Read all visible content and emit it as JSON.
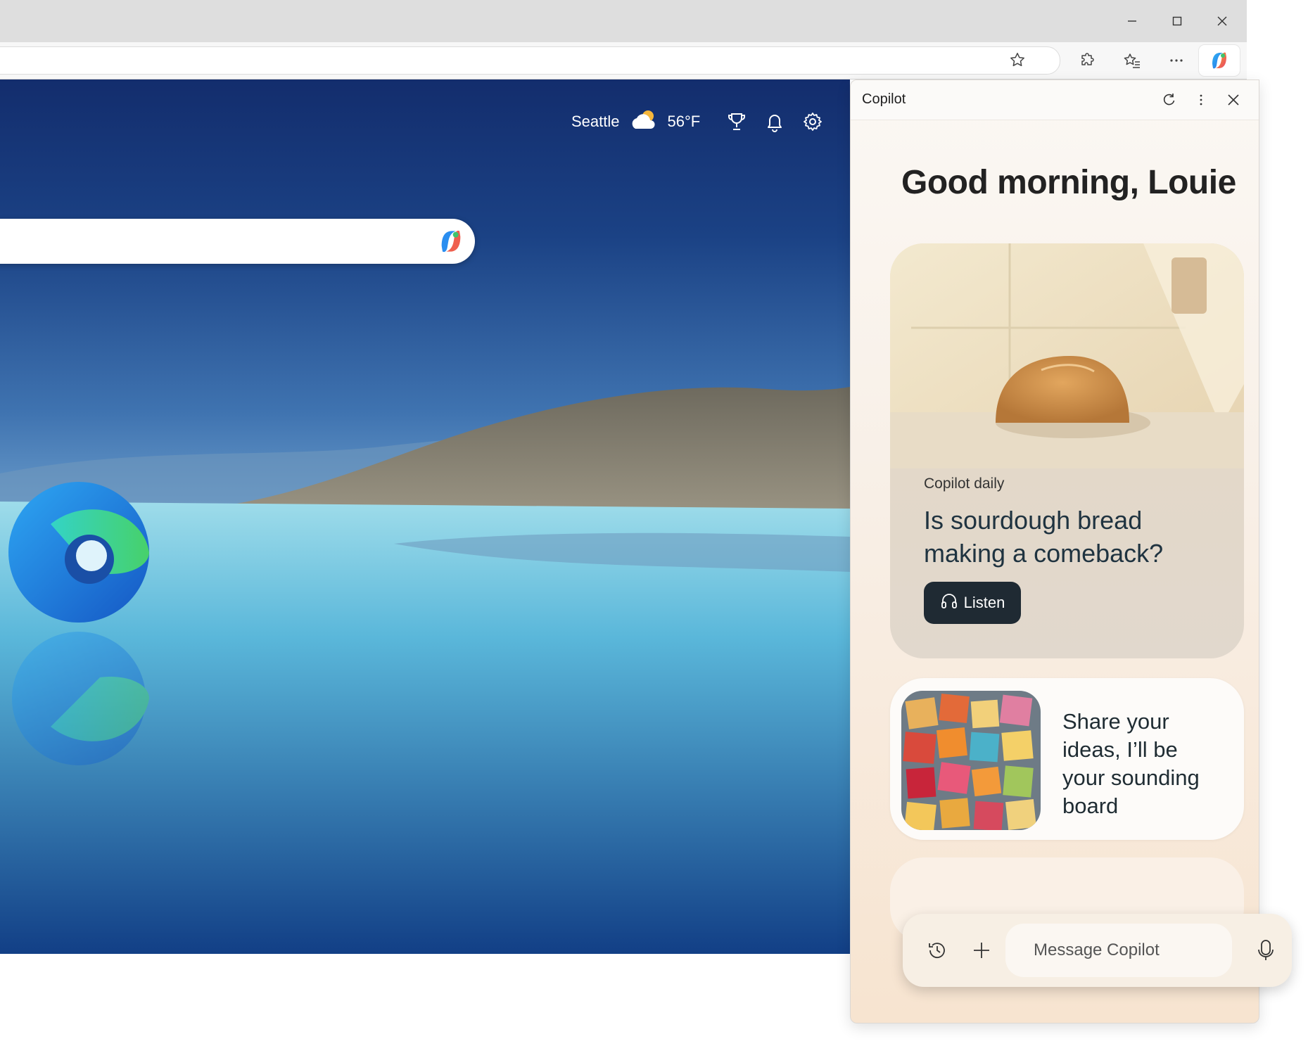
{
  "window": {
    "controls": [
      "minimize-icon",
      "maximize-icon",
      "close-icon"
    ]
  },
  "toolbar": {
    "icons": [
      "favorite-star-icon",
      "extensions-icon",
      "favorites-icon",
      "more-icon",
      "copilot-icon"
    ]
  },
  "newtab": {
    "weather": {
      "city": "Seattle",
      "temp": "56°F",
      "icon": "partly-cloudy-icon"
    },
    "icons": [
      "rewards-trophy-icon",
      "notifications-bell-icon",
      "settings-gear-icon"
    ]
  },
  "copilot": {
    "title": "Copilot",
    "header_icons": [
      "refresh-icon",
      "more-vertical-icon",
      "close-icon"
    ],
    "greeting": "Good morning, Louie",
    "daily_card": {
      "eyebrow": "Copilot daily",
      "headline": "Is sourdough bread making a comeback?",
      "listen_label": "Listen"
    },
    "idea_card": {
      "text": "Share your ideas, I’ll be your sounding board"
    },
    "composer": {
      "placeholder": "Message Copilot",
      "icons": [
        "history-icon",
        "plus-icon",
        "microphone-icon"
      ]
    }
  },
  "colors": {
    "listen_button": "#1f2a33",
    "panel_bg": "#f8efe6",
    "sky_top": "#132d6d"
  }
}
